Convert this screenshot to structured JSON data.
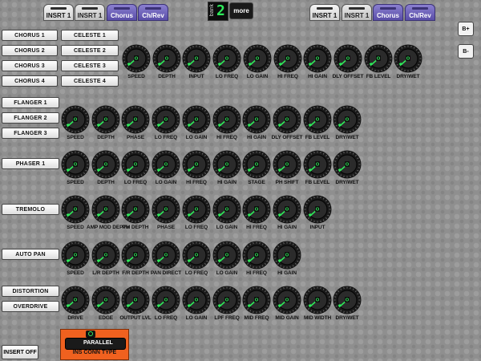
{
  "top_tabs_left": [
    "INSRT 1",
    "INSRT 1",
    "Chorus",
    "Ch/Rev"
  ],
  "top_tabs_right": [
    "INSRT 1",
    "INSRT 1",
    "Chorus",
    "Ch/Rev"
  ],
  "bank": {
    "label": "bank",
    "value": "2"
  },
  "more_label": "more",
  "side_buttons": [
    "B+",
    "B-"
  ],
  "chorus": {
    "buttons": [
      "CHORUS 1",
      "CHORUS 2",
      "CHORUS 3",
      "CHORUS 4"
    ],
    "celeste": [
      "CELESTE 1",
      "CELESTE 2",
      "CELESTE 3",
      "CELESTE 4"
    ],
    "knobs": [
      "SPEED",
      "DEPTH",
      "INPUT",
      "LO FREQ",
      "LO GAIN",
      "HI FREQ",
      "HI GAIN",
      "DLY OFFSET",
      "FB LEVEL",
      "DRY/WET"
    ]
  },
  "flanger": {
    "buttons": [
      "FLANGER 1",
      "FLANGER 2",
      "FLANGER 3"
    ],
    "knobs": [
      "SPEED",
      "DEPTH",
      "PHASE",
      "LO FREQ",
      "LO GAIN",
      "HI FREQ",
      "HI GAIN",
      "DLY OFFSET",
      "FB LEVEL",
      "DRY/WET"
    ]
  },
  "phaser": {
    "buttons": [
      "PHASER 1"
    ],
    "knobs": [
      "SPEED",
      "DEPTH",
      "LO FREQ",
      "LO GAIN",
      "HI FREQ",
      "HI GAIN",
      "STAGE",
      "PH SHIFT",
      "FB LEVEL",
      "DRY/WET"
    ]
  },
  "tremolo": {
    "buttons": [
      "TREMOLO"
    ],
    "knobs": [
      "SPEED",
      "AMP MOD DEPTH",
      "PM DEPTH",
      "PHASE",
      "LO FREQ",
      "LO GAIN",
      "HI FREQ",
      "HI GAIN",
      "INPUT"
    ]
  },
  "autopan": {
    "buttons": [
      "AUTO PAN"
    ],
    "knobs": [
      "SPEED",
      "L/R DEPTH",
      "F/R DEPTH",
      "PAN DIRECT",
      "LO FREQ",
      "LO GAIN",
      "HI FREQ",
      "HI GAIN"
    ]
  },
  "distortion": {
    "buttons": [
      "DISTORTION",
      "OVERDRIVE"
    ],
    "knobs": [
      "DRIVE",
      "EDGE",
      "OUTPUT LVL",
      "LO FREQ",
      "LO GAIN",
      "LPF FREQ",
      "MID FREQ",
      "MID GAIN",
      "MID WIDTH",
      "DRY/WET"
    ]
  },
  "ins_conn": {
    "value": "PARALLEL",
    "caption": "INS CONN TYPE"
  },
  "insert_off_label": "INSERT OFF",
  "colors": {
    "accent_green": "#2eea5a",
    "tab_purple": "#6a5ec0",
    "ins_orange": "#f0611f"
  }
}
